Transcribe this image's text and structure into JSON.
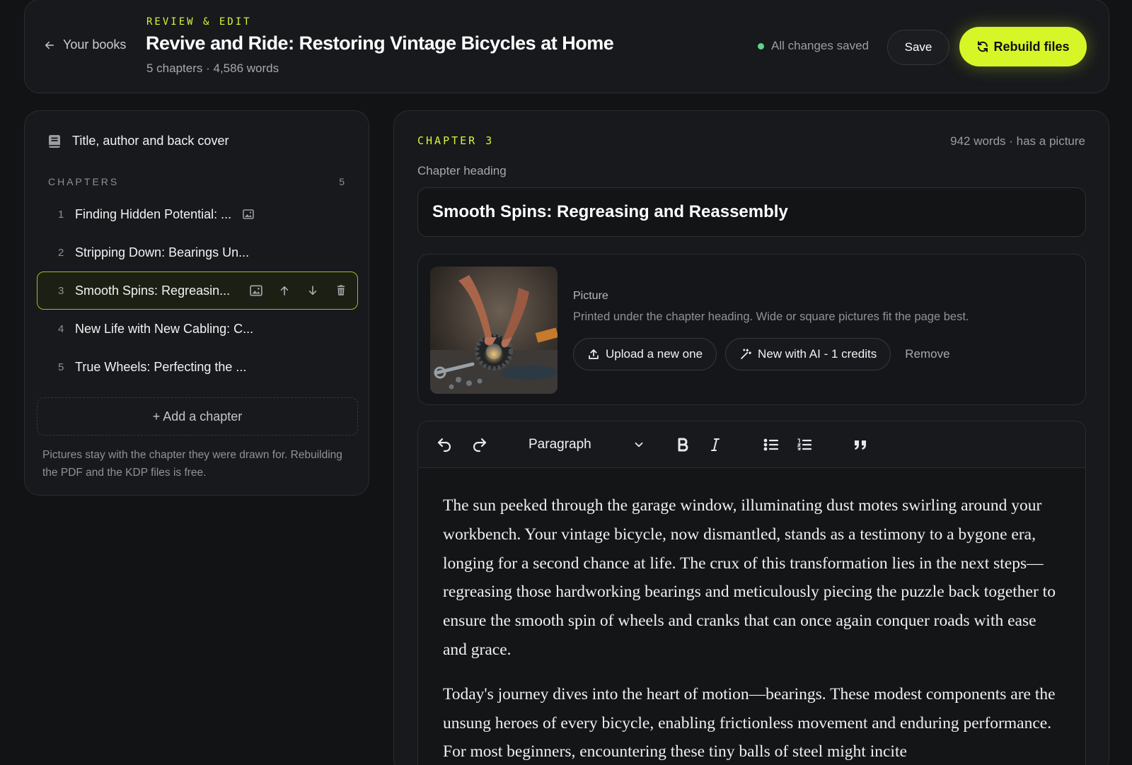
{
  "header": {
    "back_label": "Your books",
    "kicker": "REVIEW & EDIT",
    "title": "Revive and Ride: Restoring Vintage Bicycles at Home",
    "meta": "5 chapters · 4,586 words",
    "saved_status": "All changes saved",
    "save_label": "Save",
    "rebuild_label": "Rebuild files"
  },
  "sidebar": {
    "cover_label": "Title, author and back cover",
    "chapters_label": "CHAPTERS",
    "chapters_count": "5",
    "chapters": [
      {
        "num": "1",
        "title": "Finding Hidden Potential: ...",
        "has_picture": true,
        "active": false
      },
      {
        "num": "2",
        "title": "Stripping Down: Bearings Un...",
        "has_picture": false,
        "active": false
      },
      {
        "num": "3",
        "title": "Smooth Spins: Regreasin...",
        "has_picture": true,
        "active": true
      },
      {
        "num": "4",
        "title": "New Life with New Cabling: C...",
        "has_picture": false,
        "active": false
      },
      {
        "num": "5",
        "title": "True Wheels: Perfecting the ...",
        "has_picture": false,
        "active": false
      }
    ],
    "add_chapter_label": "+ Add a chapter",
    "note": "Pictures stay with the chapter they were drawn for. Rebuilding the PDF and the KDP files is free."
  },
  "editor": {
    "chapter_kicker": "CHAPTER 3",
    "chapter_meta": "942 words · has a picture",
    "heading_label": "Chapter heading",
    "heading_value": "Smooth Spins: Regreasing and Reassembly",
    "picture": {
      "label": "Picture",
      "description": "Printed under the chapter heading. Wide or square pictures fit the page best.",
      "upload_label": "Upload a new one",
      "ai_label": "New with AI - 1 credits",
      "remove_label": "Remove"
    },
    "toolbar": {
      "block_type": "Paragraph"
    },
    "paragraphs": [
      "The sun peeked through the garage window, illuminating dust motes swirling around your workbench. Your vintage bicycle, now dismantled, stands as a testimony to a bygone era, longing for a second chance at life. The crux of this transformation lies in the next steps—regreasing those hardworking bearings and meticulously piecing the puzzle back together to ensure the smooth spin of wheels and cranks that can once again conquer roads with ease and grace.",
      "Today's journey dives into the heart of motion—bearings. These modest components are the unsung heroes of every bicycle, enabling frictionless movement and enduring performance. For most beginners, encountering these tiny balls of steel might incite"
    ]
  },
  "colors": {
    "accent": "#d6f628",
    "background": "#111315",
    "panel": "#17191c",
    "saved_dot": "#5fd38a"
  }
}
